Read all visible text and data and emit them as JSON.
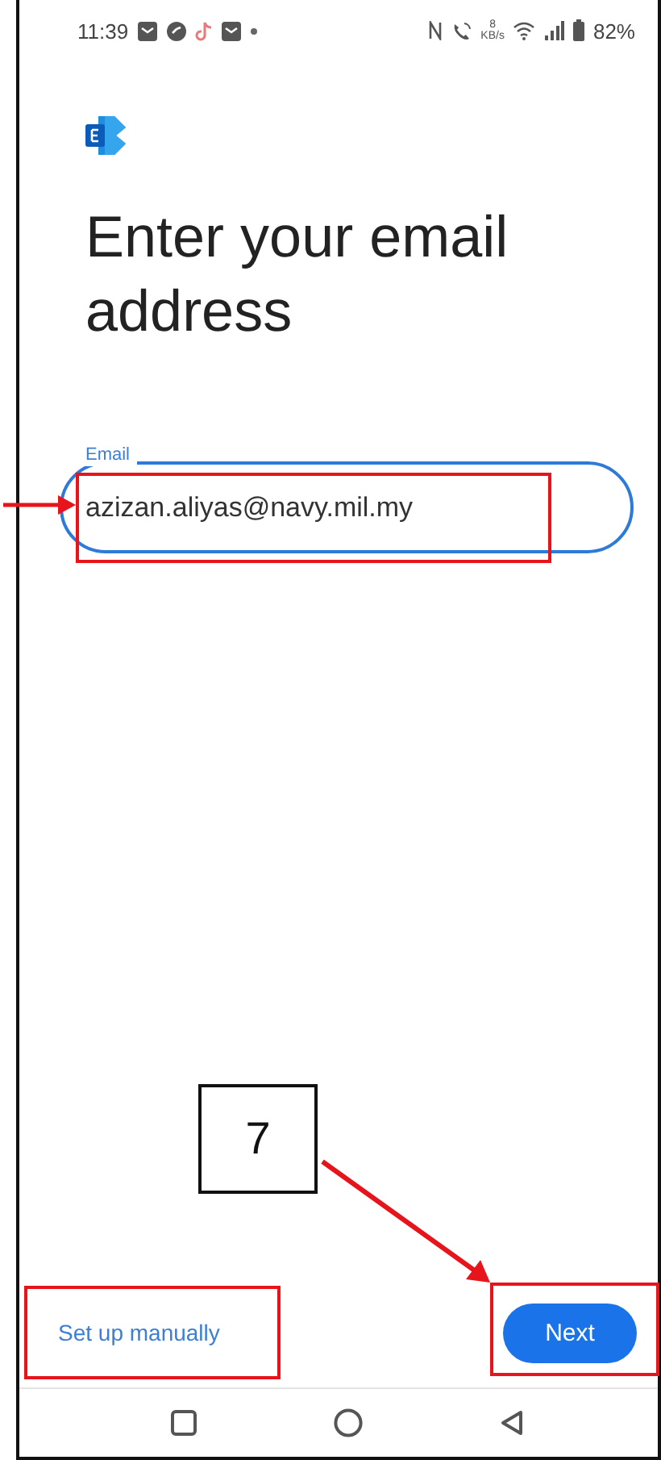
{
  "status_bar": {
    "time": "11:39",
    "network_speed_value": "8",
    "network_speed_unit": "KB/s",
    "battery": "82%"
  },
  "title": "Enter your email address",
  "email_field": {
    "label": "Email",
    "value": "azizan.aliyas@navy.mil.my"
  },
  "actions": {
    "setup_link": "Set up manually",
    "next_button": "Next"
  },
  "annotations": {
    "step_number": "7"
  }
}
